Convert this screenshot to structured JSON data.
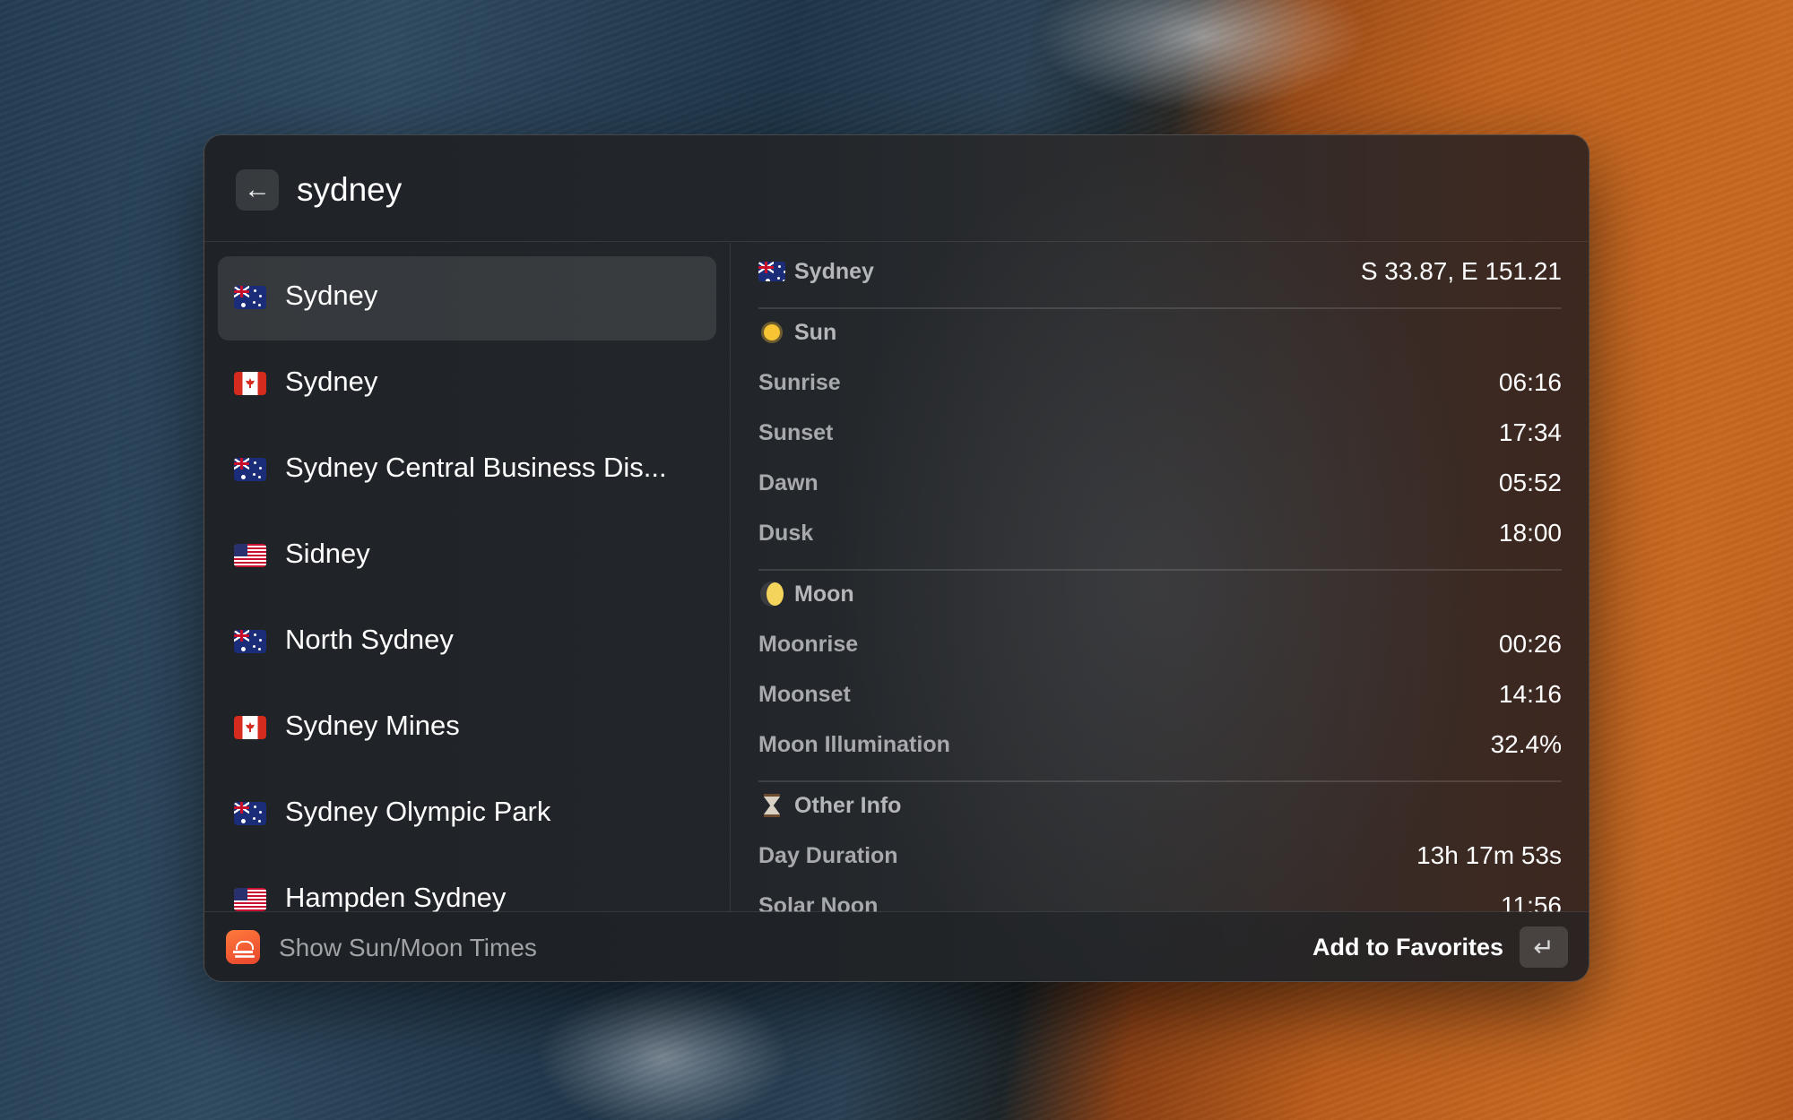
{
  "search": {
    "value": "sydney",
    "back_icon": "arrow-left-icon"
  },
  "results": [
    {
      "label": "Sydney",
      "flag": "AU",
      "selected": true
    },
    {
      "label": "Sydney",
      "flag": "CA",
      "selected": false
    },
    {
      "label": "Sydney Central Business Dis...",
      "flag": "AU",
      "selected": false
    },
    {
      "label": "Sidney",
      "flag": "US",
      "selected": false
    },
    {
      "label": "North Sydney",
      "flag": "AU",
      "selected": false
    },
    {
      "label": "Sydney Mines",
      "flag": "CA",
      "selected": false
    },
    {
      "label": "Sydney Olympic Park",
      "flag": "AU",
      "selected": false
    },
    {
      "label": "Hampden Sydney",
      "flag": "US",
      "selected": false
    }
  ],
  "detail": {
    "location": {
      "name": "Sydney",
      "flag": "AU",
      "coordinates": "S 33.87, E 151.21"
    },
    "sun": {
      "heading": "Sun",
      "icon": "sun-icon",
      "rows": [
        {
          "label": "Sunrise",
          "value": "06:16"
        },
        {
          "label": "Sunset",
          "value": "17:34"
        },
        {
          "label": "Dawn",
          "value": "05:52"
        },
        {
          "label": "Dusk",
          "value": "18:00"
        }
      ]
    },
    "moon": {
      "heading": "Moon",
      "icon": "moon-icon",
      "rows": [
        {
          "label": "Moonrise",
          "value": "00:26"
        },
        {
          "label": "Moonset",
          "value": "14:16"
        },
        {
          "label": "Moon Illumination",
          "value": "32.4%"
        }
      ]
    },
    "other": {
      "heading": "Other Info",
      "icon": "hourglass-icon",
      "rows": [
        {
          "label": "Day Duration",
          "value": "13h 17m 53s"
        },
        {
          "label": "Solar Noon",
          "value": "11:56"
        }
      ]
    }
  },
  "footer": {
    "command_title": "Show Sun/Moon Times",
    "action_label": "Add to Favorites",
    "action_key": "↵",
    "app_icon": "sunrise-icon"
  },
  "colors": {
    "accent_app_icon": "#e8452c",
    "sun_icon": "#f8c433",
    "moon_icon": "#f4d45a"
  }
}
